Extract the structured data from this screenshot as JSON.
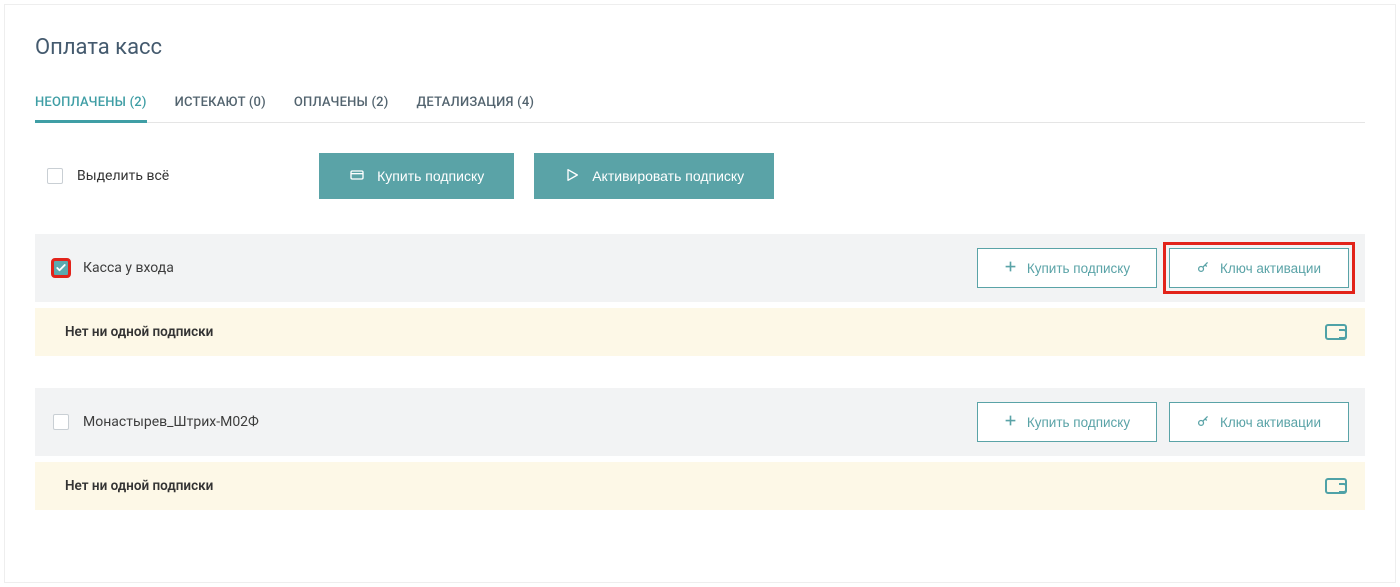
{
  "page": {
    "title": "Оплата касс"
  },
  "tabs": [
    {
      "label": "НЕОПЛАЧЕНЫ (2)",
      "active": true
    },
    {
      "label": "ИСТЕКАЮТ (0)",
      "active": false
    },
    {
      "label": "ОПЛАЧЕНЫ (2)",
      "active": false
    },
    {
      "label": "ДЕТАЛИЗАЦИЯ (4)",
      "active": false
    }
  ],
  "toolbar": {
    "select_all_label": "Выделить всё",
    "buy_label": "Купить подписку",
    "activate_label": "Активировать подписку"
  },
  "row_buttons": {
    "buy_label": "Купить подписку",
    "key_label": "Ключ активации"
  },
  "notice_text": "Нет ни одной подписки",
  "registers": [
    {
      "name": "Касса у входа",
      "checked": true,
      "highlight": true
    },
    {
      "name": "Монастырев_Штрих-М02Ф",
      "checked": false,
      "highlight": false
    }
  ],
  "colors": {
    "accent": "#5aa3a7",
    "accent_text": "#3f9ea5",
    "highlight_red": "#e2231a",
    "notice_bg": "#fdf8e7",
    "row_bg": "#f2f3f4"
  }
}
